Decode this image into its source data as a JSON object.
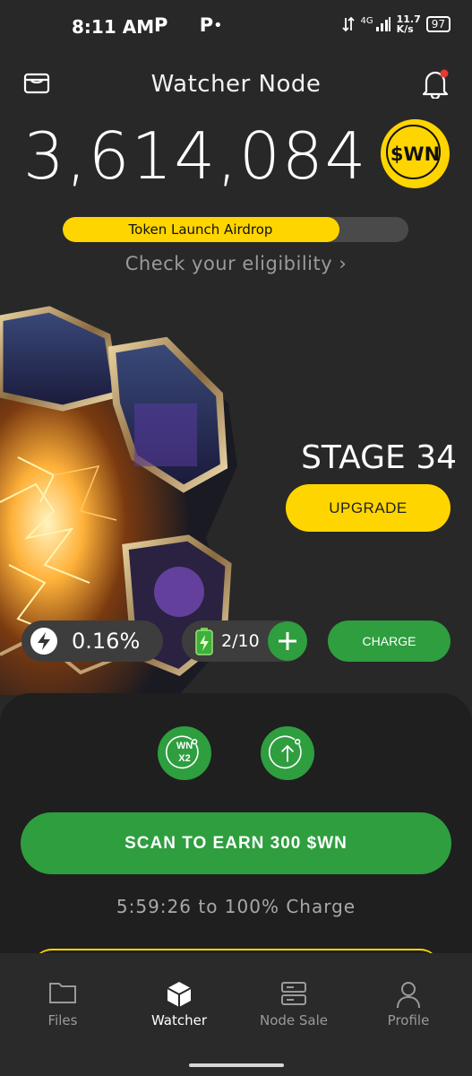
{
  "status_bar": {
    "time": "8:11 AM",
    "notif_icons": "P P",
    "dot": "•",
    "network": "4G",
    "speed_value": "11.7",
    "speed_unit": "K/s",
    "battery": "97"
  },
  "header": {
    "title": "Watcher Node",
    "left_icon": "wallet-icon",
    "right_icon": "bell-icon",
    "notification_dot_color": "#e53935"
  },
  "balance": {
    "amount": "3,614,084",
    "token": "$WN"
  },
  "airdrop": {
    "label": "Token Launch Airdrop",
    "progress": 0.8,
    "eligibility_link": "Check your eligibility ›"
  },
  "stage": {
    "label": "STAGE 34",
    "upgrade_label": "UPGRADE"
  },
  "stats": {
    "rate": "0.16%",
    "charges": "2/10",
    "charge_label": "CHARGE"
  },
  "actions": {
    "x2_line1": "WN",
    "x2_line2": "X2",
    "scan_label": "SCAN TO EARN 300 $WN",
    "countdown": "5:59:26 to 100% Charge"
  },
  "nav": {
    "items": [
      {
        "label": "Files",
        "icon": "folder-icon",
        "active": false
      },
      {
        "label": "Watcher",
        "icon": "cube-icon",
        "active": true
      },
      {
        "label": "Node Sale",
        "icon": "server-icon",
        "active": false
      },
      {
        "label": "Profile",
        "icon": "person-icon",
        "active": false
      }
    ]
  },
  "colors": {
    "background": "#282828",
    "accent_yellow": "#ffd500",
    "accent_green": "#2e9e3f"
  }
}
